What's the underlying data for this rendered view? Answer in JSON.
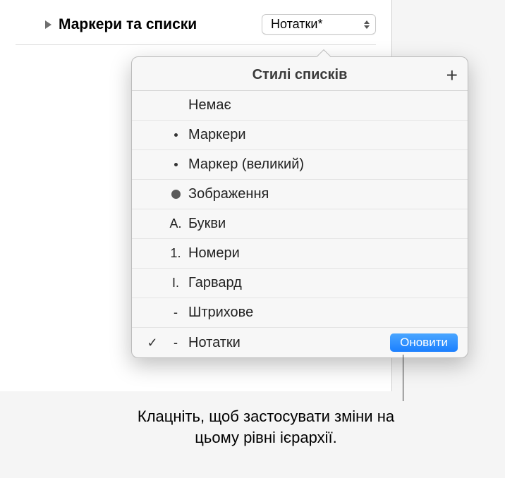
{
  "section": {
    "label": "Маркери та списки",
    "dropdown_value": "Нотатки*"
  },
  "popover": {
    "title": "Стилі списків",
    "items": [
      {
        "bullet": "",
        "label": "Немає",
        "checked": false
      },
      {
        "bullet": "·s",
        "label": "Маркери",
        "checked": false
      },
      {
        "bullet": "·s",
        "label": "Маркер (великий)",
        "checked": false
      },
      {
        "bullet": "●",
        "label": "Зображення",
        "checked": false
      },
      {
        "bullet": "A.",
        "label": "Букви",
        "checked": false
      },
      {
        "bullet": "1.",
        "label": "Номери",
        "checked": false
      },
      {
        "bullet": "I.",
        "label": "Гарвард",
        "checked": false
      },
      {
        "bullet": "-",
        "label": "Штрихове",
        "checked": false
      },
      {
        "bullet": "-",
        "label": "Нотатки",
        "checked": true
      }
    ],
    "update_label": "Оновити"
  },
  "callout": {
    "text": "Клацніть, щоб застосувати зміни на цьому рівні ієрархії."
  }
}
